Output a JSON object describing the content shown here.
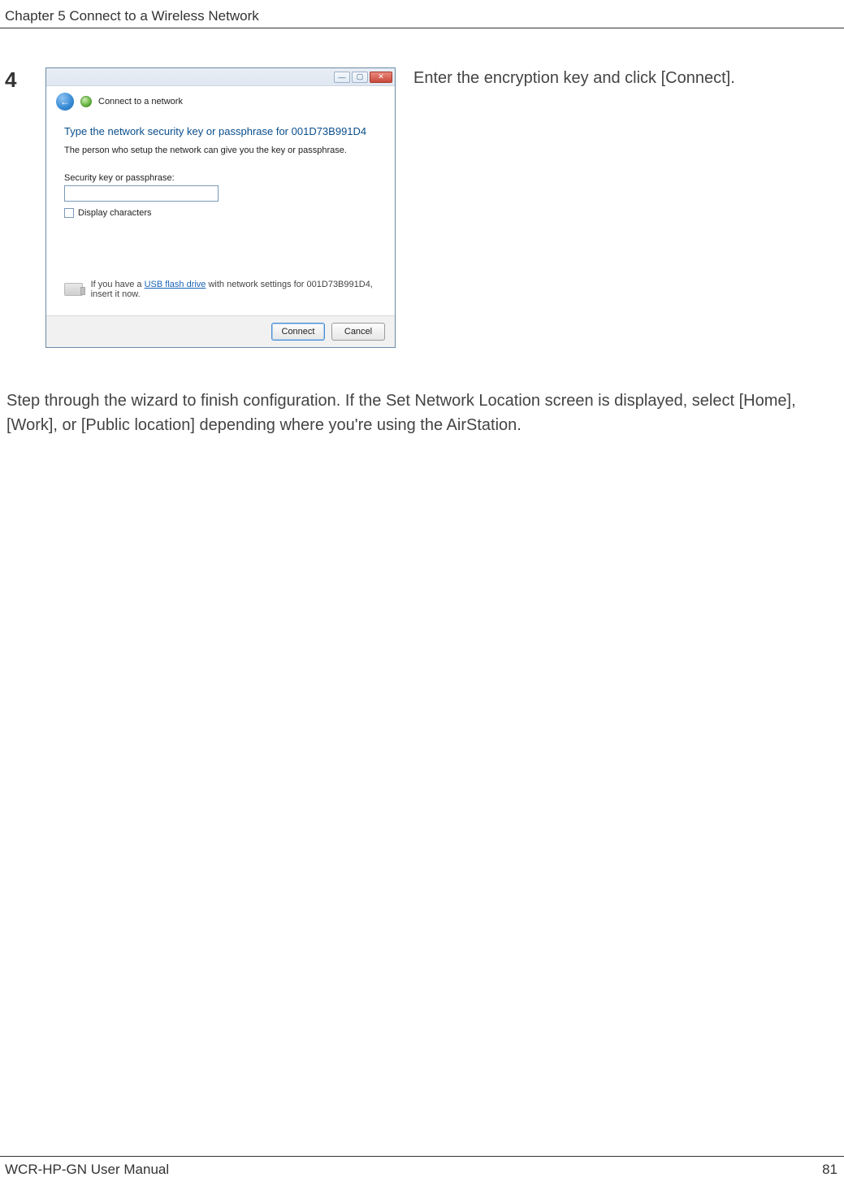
{
  "header": {
    "chapter": "Chapter 5  Connect to a Wireless Network"
  },
  "step": {
    "number": "4",
    "instruction": "Enter the encryption key and click [Connect]."
  },
  "followup": "Step through the wizard to finish configuration.  If the Set Network Location screen is displayed, select [Home], [Work], or [Public location] depending where you're using the AirStation.",
  "dialog": {
    "nav_title": "Connect to a network",
    "headline": "Type the network security key or passphrase for 001D73B991D4",
    "subtext": "The person who setup the network can give you the key or passphrase.",
    "input_label": "Security key or passphrase:",
    "display_chars": "Display characters",
    "hint_prefix": "If you have a ",
    "hint_link": "USB flash drive",
    "hint_suffix": " with network settings for 001D73B991D4, insert it now.",
    "connect": "Connect",
    "cancel": "Cancel"
  },
  "footer": {
    "manual": "WCR-HP-GN User Manual",
    "page": "81"
  }
}
